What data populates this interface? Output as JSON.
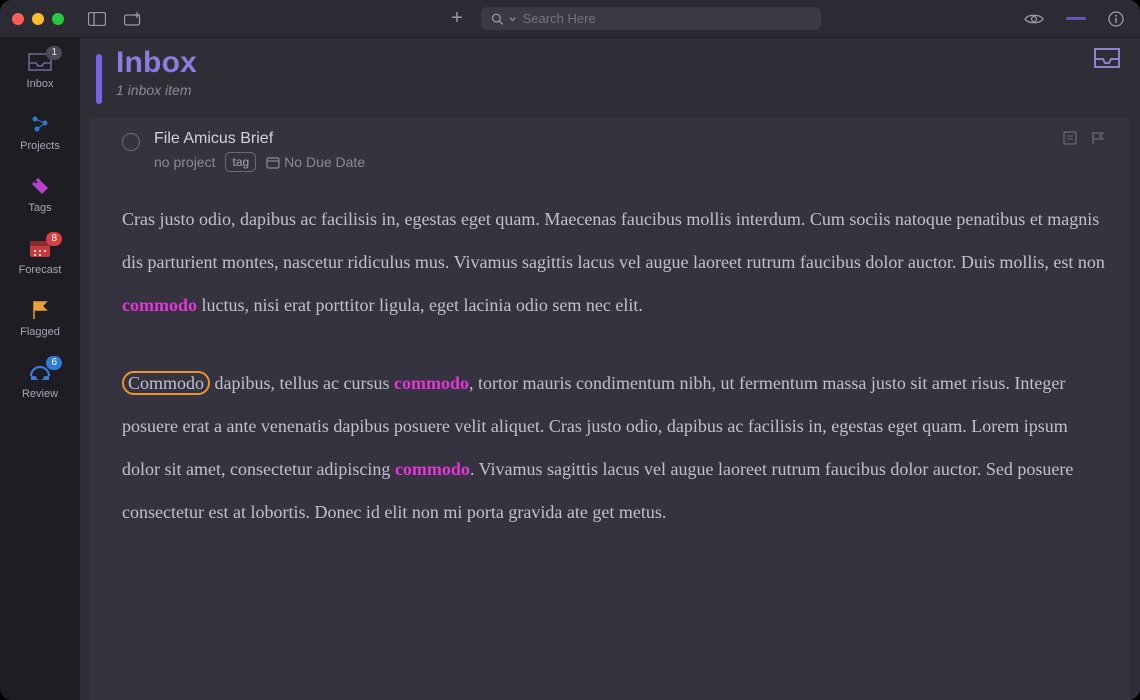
{
  "search": {
    "placeholder": "Search Here"
  },
  "sidebar": {
    "items": [
      {
        "label": "Inbox",
        "badge": "1"
      },
      {
        "label": "Projects"
      },
      {
        "label": "Tags"
      },
      {
        "label": "Forecast",
        "badge": "8"
      },
      {
        "label": "Flagged"
      },
      {
        "label": "Review",
        "badge": "6"
      }
    ]
  },
  "header": {
    "title": "Inbox",
    "subtitle": "1 inbox item"
  },
  "task": {
    "title": "File Amicus Brief",
    "project": "no project",
    "tag_label": "tag",
    "due_label": "No Due Date"
  },
  "note": {
    "p1a": "Cras justo odio, dapibus ac facilisis in, egestas eget quam. Maecenas faucibus mollis interdum. Cum sociis natoque penatibus et magnis dis parturient montes, nascetur ridiculus mus. Vivamus sagittis lacus vel augue laoreet rutrum faucibus dolor auctor. Duis mollis, est non ",
    "p1_hl1": "commodo",
    "p1b": " luctus, nisi erat porttitor ligula, eget lacinia odio sem nec elit.",
    "p2_sel": "Commodo",
    "p2a": " dapibus, tellus ac cursus ",
    "p2_hl1": "commodo",
    "p2b": ", tortor mauris condimentum nibh, ut fermentum massa justo sit amet risus. Integer posuere erat a ante venenatis dapibus posuere velit aliquet. Cras justo odio, dapibus ac facilisis in, egestas eget quam. Lorem ipsum dolor sit amet, consectetur adipiscing ",
    "p2_hl2": "commodo",
    "p2c": ". Vivamus sagittis lacus vel augue laoreet rutrum faucibus dolor auctor. Sed posuere consectetur est at lobortis. Donec id elit non mi porta gravida ate get metus."
  }
}
